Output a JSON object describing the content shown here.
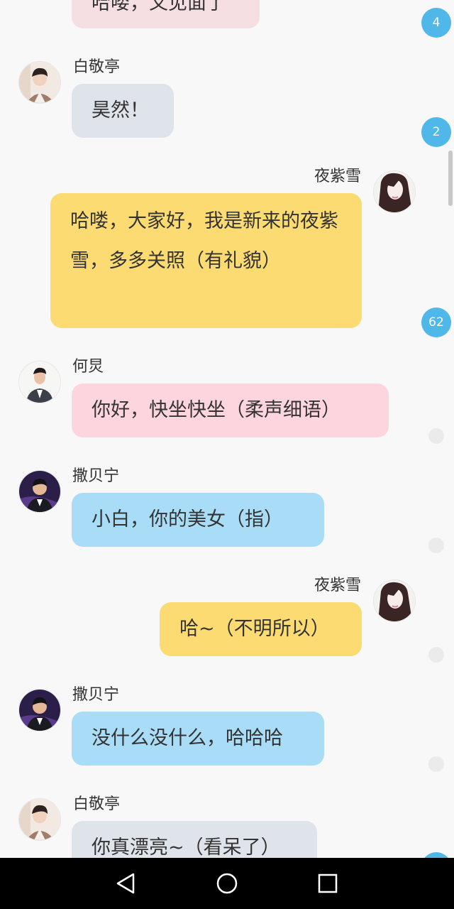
{
  "colors": {
    "badge": "#4fb8e8",
    "bubble_gray": "#dfe3ea",
    "bubble_yellow": "#fcdc72",
    "bubble_pink": "#fdd5df",
    "bubble_blue": "#a9dcf6",
    "bubble_top": "#f5dfe2"
  },
  "messages": [
    {
      "id": "m0",
      "sender": "",
      "avatar": "",
      "text": "哈喽，又见面了",
      "side": "left"
    },
    {
      "id": "m1",
      "sender": "白敬亭",
      "avatar": "user-avatar-icon",
      "text": "昊然！",
      "side": "left"
    },
    {
      "id": "m2",
      "sender": "夜紫雪",
      "avatar": "user-avatar-icon",
      "text": "哈喽，大家好，我是新来的夜紫雪，多多关照（有礼貌）",
      "side": "right"
    },
    {
      "id": "m3",
      "sender": "何炅",
      "avatar": "user-avatar-icon",
      "text": "你好，快坐快坐（柔声细语）",
      "side": "left"
    },
    {
      "id": "m4",
      "sender": "撒贝宁",
      "avatar": "user-avatar-icon",
      "text": "小白，你的美女（指）",
      "side": "left"
    },
    {
      "id": "m5",
      "sender": "夜紫雪",
      "avatar": "user-avatar-icon",
      "text": "哈~（不明所以）",
      "side": "right"
    },
    {
      "id": "m6",
      "sender": "撒贝宁",
      "avatar": "user-avatar-icon",
      "text": "没什么没什么，哈哈哈",
      "side": "left"
    },
    {
      "id": "m7",
      "sender": "白敬亭",
      "avatar": "user-avatar-icon",
      "text": "你真漂亮~（看呆了）",
      "side": "left"
    }
  ],
  "badges": [
    "4",
    "2",
    "62"
  ],
  "navbar": {
    "back": "back-icon",
    "home": "home-icon",
    "recents": "recents-icon"
  }
}
